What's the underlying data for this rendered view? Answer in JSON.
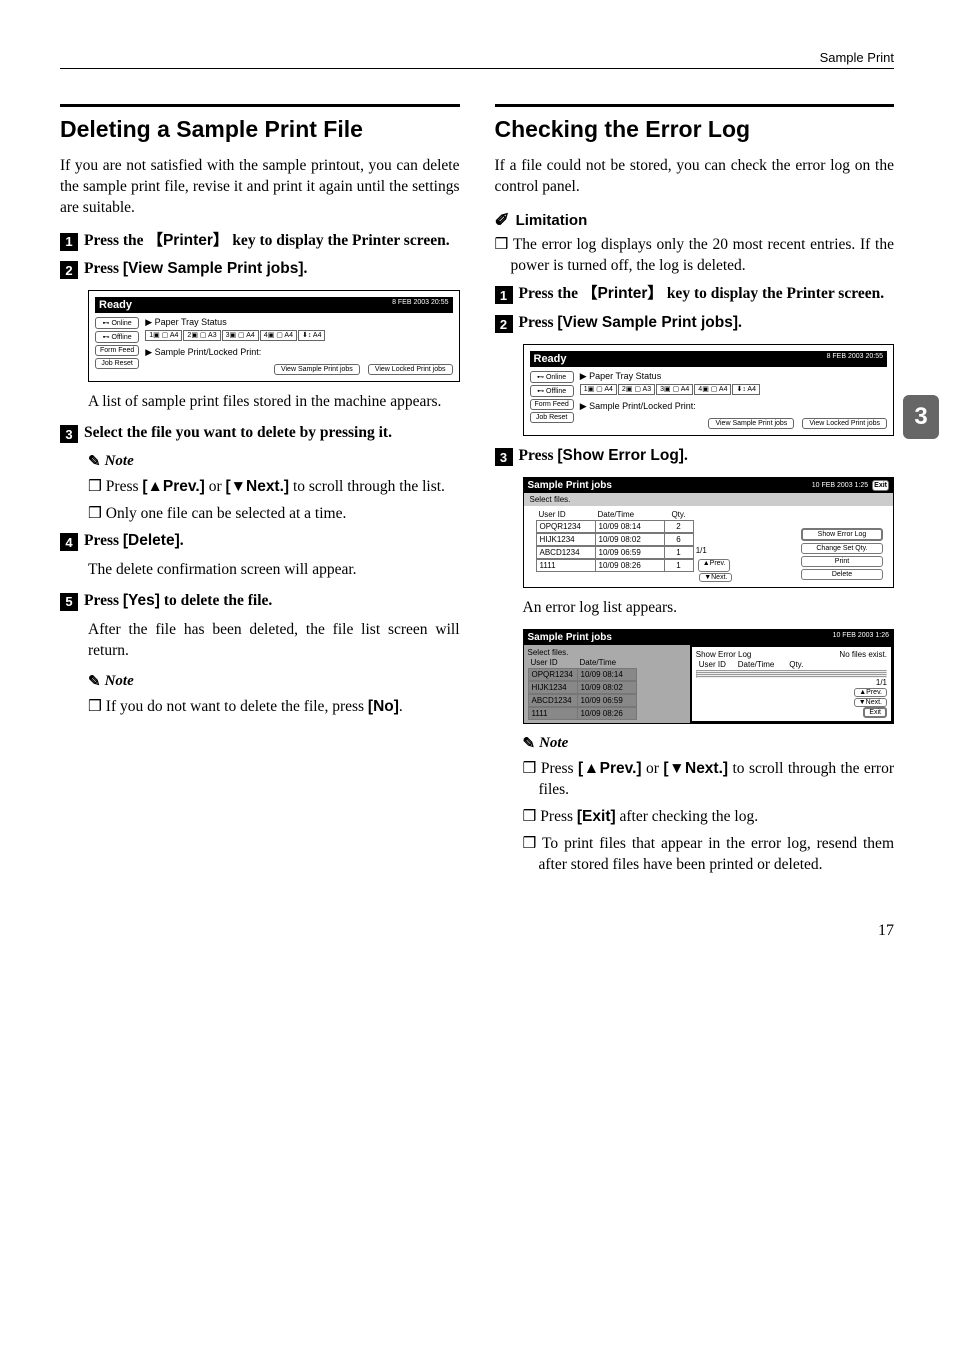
{
  "header": {
    "label": "Sample Print"
  },
  "side_tab": "3",
  "left": {
    "title": "Deleting a Sample Print File",
    "intro": "If you are not satisfied with the sample printout, you can delete the sample print file, revise it and print it again until the settings are suitable.",
    "steps": {
      "s1_pre": "Press the ",
      "s1_key": "Printer",
      "s1_post": " key to display the Printer screen.",
      "s2_pre": "Press ",
      "s2_btn": "[View Sample Print jobs]",
      "s2_post": ".",
      "s2_result": "A list of sample print files stored in the machine appears.",
      "s3": "Select the file you want to delete by pressing it.",
      "s4_pre": "Press ",
      "s4_btn": "[Delete]",
      "s4_post": ".",
      "s4_result": "The delete confirmation screen will appear.",
      "s5_pre": "Press ",
      "s5_btn": "[Yes]",
      "s5_post": " to delete the file.",
      "s5_result": "After the file has been deleted, the file list screen will return."
    },
    "note_h": "Note",
    "notes1": {
      "n1_pre": "Press ",
      "n1_prev": "[▲Prev.]",
      "n1_mid": " or ",
      "n1_next": "[▼Next.]",
      "n1_post": " to scroll through the list.",
      "n2": "Only one file can be selected at a time."
    },
    "notes2": {
      "n1_pre": "If you do not want to delete the file, press ",
      "n1_btn": "[No]",
      "n1_post": "."
    }
  },
  "right": {
    "title": "Checking the Error Log",
    "intro": "If a file could not be stored, you can check the error log on the control panel.",
    "limitation_h": "Limitation",
    "limitation": "The error log displays only the 20 most recent entries. If the power is turned off, the log is deleted.",
    "steps": {
      "s1_pre": "Press the ",
      "s1_key": "Printer",
      "s1_post": " key to display the Printer screen.",
      "s2_pre": "Press ",
      "s2_btn": "[View Sample Print jobs]",
      "s2_post": ".",
      "s3_pre": "Press ",
      "s3_btn": "[Show Error Log]",
      "s3_post": ".",
      "s3_result": "An error log list appears."
    },
    "note_h": "Note",
    "notes": {
      "n1_pre": "Press ",
      "n1_prev": "[▲Prev.]",
      "n1_mid": " or ",
      "n1_next": "[▼Next.]",
      "n1_post": " to scroll through the error files.",
      "n2_pre": "Press ",
      "n2_btn": "[Exit]",
      "n2_post": " after checking the log.",
      "n3": "To print files that appear in the error log, resend them after stored files have been printed or deleted."
    }
  },
  "figures": {
    "ready_panel": {
      "title": "Ready",
      "timestamp": "8 FEB 2003 20:55",
      "online": "⊷ Online",
      "offline": "⊷ Offline",
      "formfeed": "Form Feed",
      "jobreset": "Job Reset",
      "tray_status": "▶ Paper Tray Status",
      "sample_locked": "▶ Sample Print/Locked Print:",
      "view_sample": "View Sample Print jobs",
      "view_locked": "View Locked Print jobs",
      "trays": [
        "1▣ ▢\nA4",
        "2▣ ▢\nA3",
        "3▣ ▢\nA4",
        "4▣ ▢\nA4",
        "⬇↕\nA4"
      ]
    },
    "jobs_table": {
      "title": "Sample Print jobs",
      "timestamp": "10 FEB 2003 1:25",
      "select": "Select files.",
      "exit": "Exit",
      "head_user": "User ID",
      "head_date": "Date/Time",
      "head_qty": "Qty.",
      "rows": [
        {
          "user": "OPQR1234",
          "date": "10/09 08:14",
          "qty": "2"
        },
        {
          "user": "HIJK1234",
          "date": "10/09 08:02",
          "qty": "6"
        },
        {
          "user": "ABCD1234",
          "date": "10/09 06:59",
          "qty": "1"
        },
        {
          "user": "1111",
          "date": "10/09 08:26",
          "qty": "1"
        }
      ],
      "page": "1/1",
      "prev": "▲Prev.",
      "next": "▼Next.",
      "show_error": "Show Error Log",
      "change": "Change Set Qty.",
      "print": "Print",
      "delete": "Delete"
    },
    "error_log": {
      "title": "Sample Print jobs",
      "timestamp": "10 FEB 2003 1:26",
      "select": "Select files.",
      "panel_h": "Show Error Log",
      "no_files": "No files exist.",
      "head_user": "User ID",
      "head_date": "Date/Time",
      "head_qty": "Qty.",
      "rows": [
        {
          "user": "OPQR1234",
          "date": "10/09 08:14"
        },
        {
          "user": "HIJK1234",
          "date": "10/09 08:02"
        },
        {
          "user": "ABCD1234",
          "date": "10/09 06:59"
        },
        {
          "user": "1111",
          "date": "10/09 08:26"
        }
      ],
      "page": "1/1",
      "prev": "▲Prev.",
      "next": "▼Next.",
      "exit": "Exit"
    }
  },
  "page_number": "17"
}
